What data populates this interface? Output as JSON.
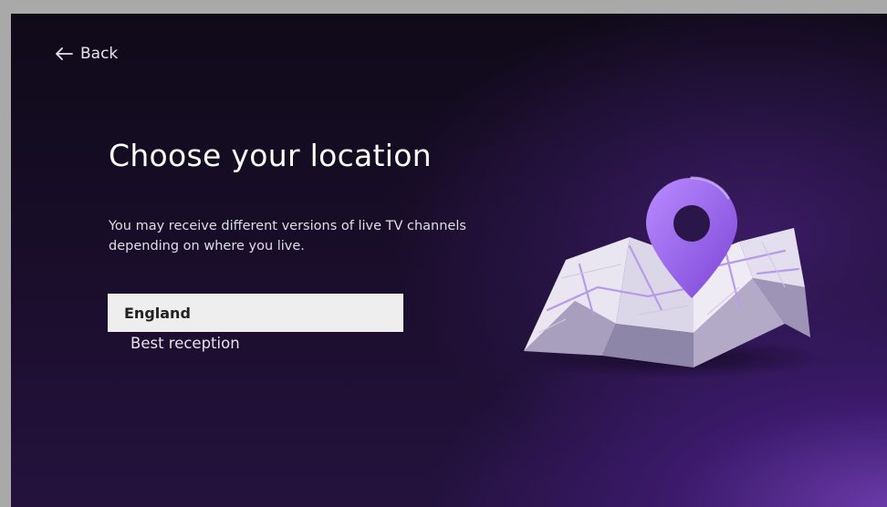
{
  "nav": {
    "back_label": "Back"
  },
  "page": {
    "title": "Choose your location",
    "description": "You may receive different versions of live TV channels depending on where you live."
  },
  "options": [
    {
      "label": "England",
      "selected": true
    },
    {
      "label": "Best reception",
      "selected": false
    }
  ],
  "colors": {
    "accent": "#9a63e8",
    "selected_bg": "#eeeeee",
    "background_dark": "#110b1b"
  },
  "illustration": {
    "icon": "map-pin-icon"
  }
}
